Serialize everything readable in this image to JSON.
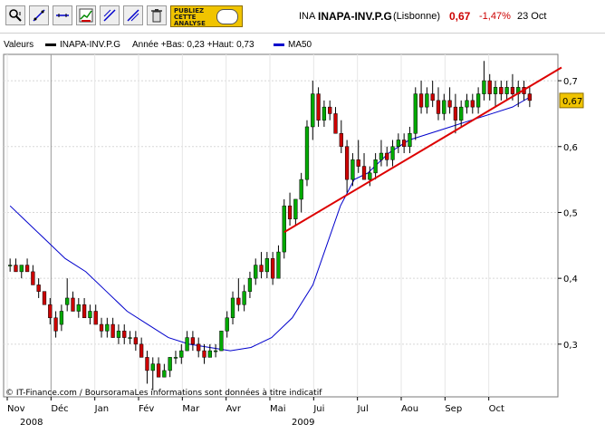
{
  "toolbar": {
    "tools": [
      {
        "icon": "zoom-icon"
      },
      {
        "icon": "line-tool-icon"
      },
      {
        "icon": "horizontal-line-icon"
      },
      {
        "icon": "indicator-icon"
      },
      {
        "icon": "trend-tool-icon"
      },
      {
        "icon": "parallel-tool-icon"
      },
      {
        "icon": "trash-icon"
      }
    ],
    "publish_lines": [
      "PUBLIEZ",
      "CETTE",
      "ANALYSE"
    ]
  },
  "quote": {
    "code": "INA",
    "name": "INAPA-INV.P.G",
    "market": "(Lisbonne)",
    "price": "0,67",
    "change": "-1,47%",
    "date": "23 Oct"
  },
  "legend": {
    "title": "Valeurs",
    "series_name": "INAPA-INV.P.G",
    "range_text": "Année +Bas: 0,23 +Haut: 0,73",
    "ma_name": "MA50",
    "ma_color": "#0000cc",
    "price_color": "#000000"
  },
  "footer": {
    "credit": "© IT-Finance.com / BoursoramaLes informations sont données à titre indicatif"
  },
  "chart_data": {
    "type": "candlestick",
    "y_ticks": [
      "0,7",
      "0,6",
      "0,5",
      "0,4",
      "0,3"
    ],
    "ylim": [
      0.22,
      0.74
    ],
    "x_months": [
      "Nov",
      "Déc",
      "Jan",
      "Fév",
      "Mar",
      "Avr",
      "Mai",
      "Jui",
      "Jul",
      "Aou",
      "Sep",
      "Oct"
    ],
    "x_years": [
      "2008",
      "2009"
    ],
    "last_price_label": "0,67",
    "up_color": "#00aa00",
    "down_color": "#cc0000",
    "trendline_color": "#dd0000",
    "candles": [
      [
        0.42,
        0.43,
        0.41,
        0.42
      ],
      [
        0.42,
        0.43,
        0.41,
        0.41
      ],
      [
        0.41,
        0.42,
        0.4,
        0.42
      ],
      [
        0.42,
        0.43,
        0.41,
        0.41
      ],
      [
        0.41,
        0.42,
        0.39,
        0.39
      ],
      [
        0.39,
        0.4,
        0.37,
        0.38
      ],
      [
        0.38,
        0.38,
        0.36,
        0.36
      ],
      [
        0.36,
        0.37,
        0.33,
        0.34
      ],
      [
        0.34,
        0.35,
        0.31,
        0.32
      ],
      [
        0.33,
        0.36,
        0.32,
        0.35
      ],
      [
        0.36,
        0.4,
        0.35,
        0.37
      ],
      [
        0.37,
        0.38,
        0.35,
        0.35
      ],
      [
        0.35,
        0.37,
        0.34,
        0.36
      ],
      [
        0.36,
        0.37,
        0.34,
        0.34
      ],
      [
        0.34,
        0.36,
        0.33,
        0.35
      ],
      [
        0.35,
        0.36,
        0.33,
        0.33
      ],
      [
        0.33,
        0.34,
        0.31,
        0.32
      ],
      [
        0.32,
        0.34,
        0.31,
        0.33
      ],
      [
        0.33,
        0.34,
        0.31,
        0.31
      ],
      [
        0.31,
        0.33,
        0.3,
        0.32
      ],
      [
        0.32,
        0.33,
        0.3,
        0.31
      ],
      [
        0.31,
        0.32,
        0.3,
        0.31
      ],
      [
        0.31,
        0.32,
        0.29,
        0.3
      ],
      [
        0.3,
        0.31,
        0.28,
        0.28
      ],
      [
        0.28,
        0.29,
        0.24,
        0.26
      ],
      [
        0.26,
        0.28,
        0.23,
        0.27
      ],
      [
        0.27,
        0.28,
        0.25,
        0.25
      ],
      [
        0.25,
        0.27,
        0.25,
        0.26
      ],
      [
        0.26,
        0.28,
        0.25,
        0.28
      ],
      [
        0.28,
        0.29,
        0.27,
        0.28
      ],
      [
        0.28,
        0.3,
        0.27,
        0.29
      ],
      [
        0.29,
        0.32,
        0.29,
        0.31
      ],
      [
        0.31,
        0.32,
        0.29,
        0.3
      ],
      [
        0.3,
        0.31,
        0.28,
        0.29
      ],
      [
        0.29,
        0.3,
        0.27,
        0.28
      ],
      [
        0.28,
        0.3,
        0.28,
        0.29
      ],
      [
        0.29,
        0.3,
        0.28,
        0.29
      ],
      [
        0.29,
        0.32,
        0.29,
        0.32
      ],
      [
        0.32,
        0.35,
        0.31,
        0.34
      ],
      [
        0.34,
        0.38,
        0.33,
        0.37
      ],
      [
        0.37,
        0.4,
        0.35,
        0.36
      ],
      [
        0.36,
        0.39,
        0.35,
        0.38
      ],
      [
        0.38,
        0.41,
        0.37,
        0.4
      ],
      [
        0.4,
        0.43,
        0.39,
        0.42
      ],
      [
        0.42,
        0.44,
        0.4,
        0.41
      ],
      [
        0.41,
        0.44,
        0.4,
        0.43
      ],
      [
        0.43,
        0.44,
        0.39,
        0.4
      ],
      [
        0.4,
        0.45,
        0.4,
        0.44
      ],
      [
        0.44,
        0.52,
        0.43,
        0.51
      ],
      [
        0.51,
        0.53,
        0.48,
        0.49
      ],
      [
        0.49,
        0.52,
        0.48,
        0.52
      ],
      [
        0.52,
        0.56,
        0.5,
        0.55
      ],
      [
        0.55,
        0.64,
        0.54,
        0.63
      ],
      [
        0.63,
        0.7,
        0.61,
        0.68
      ],
      [
        0.68,
        0.69,
        0.63,
        0.64
      ],
      [
        0.64,
        0.67,
        0.63,
        0.66
      ],
      [
        0.66,
        0.67,
        0.64,
        0.65
      ],
      [
        0.65,
        0.66,
        0.62,
        0.62
      ],
      [
        0.62,
        0.64,
        0.59,
        0.6
      ],
      [
        0.6,
        0.61,
        0.53,
        0.55
      ],
      [
        0.55,
        0.59,
        0.54,
        0.58
      ],
      [
        0.58,
        0.61,
        0.56,
        0.57
      ],
      [
        0.57,
        0.59,
        0.55,
        0.55
      ],
      [
        0.55,
        0.57,
        0.54,
        0.56
      ],
      [
        0.56,
        0.59,
        0.55,
        0.58
      ],
      [
        0.58,
        0.61,
        0.57,
        0.59
      ],
      [
        0.59,
        0.6,
        0.57,
        0.58
      ],
      [
        0.58,
        0.61,
        0.57,
        0.6
      ],
      [
        0.6,
        0.62,
        0.59,
        0.61
      ],
      [
        0.61,
        0.62,
        0.59,
        0.6
      ],
      [
        0.6,
        0.63,
        0.59,
        0.62
      ],
      [
        0.62,
        0.69,
        0.61,
        0.68
      ],
      [
        0.68,
        0.7,
        0.65,
        0.66
      ],
      [
        0.66,
        0.69,
        0.65,
        0.68
      ],
      [
        0.68,
        0.7,
        0.66,
        0.67
      ],
      [
        0.67,
        0.69,
        0.64,
        0.65
      ],
      [
        0.65,
        0.68,
        0.64,
        0.67
      ],
      [
        0.67,
        0.69,
        0.65,
        0.66
      ],
      [
        0.66,
        0.68,
        0.62,
        0.64
      ],
      [
        0.64,
        0.67,
        0.63,
        0.66
      ],
      [
        0.66,
        0.68,
        0.65,
        0.67
      ],
      [
        0.67,
        0.68,
        0.65,
        0.66
      ],
      [
        0.66,
        0.69,
        0.65,
        0.68
      ],
      [
        0.68,
        0.73,
        0.67,
        0.7
      ],
      [
        0.7,
        0.71,
        0.67,
        0.68
      ],
      [
        0.68,
        0.7,
        0.66,
        0.69
      ],
      [
        0.69,
        0.7,
        0.67,
        0.68
      ],
      [
        0.68,
        0.7,
        0.67,
        0.69
      ],
      [
        0.69,
        0.71,
        0.67,
        0.68
      ],
      [
        0.68,
        0.7,
        0.66,
        0.69
      ],
      [
        0.69,
        0.7,
        0.67,
        0.68
      ],
      [
        0.68,
        0.69,
        0.66,
        0.67
      ]
    ],
    "ma50": [
      [
        0,
        0.51
      ],
      [
        4,
        0.49
      ],
      [
        10,
        0.46
      ],
      [
        16,
        0.43
      ],
      [
        22,
        0.41
      ],
      [
        28,
        0.38
      ],
      [
        34,
        0.35
      ],
      [
        40,
        0.33
      ],
      [
        46,
        0.31
      ],
      [
        52,
        0.3
      ],
      [
        58,
        0.295
      ],
      [
        64,
        0.29
      ],
      [
        70,
        0.295
      ],
      [
        76,
        0.31
      ],
      [
        82,
        0.34
      ],
      [
        88,
        0.39
      ],
      [
        92,
        0.45
      ],
      [
        96,
        0.51
      ],
      [
        100,
        0.55
      ],
      [
        104,
        0.56
      ],
      [
        110,
        0.59
      ],
      [
        116,
        0.61
      ],
      [
        122,
        0.62
      ],
      [
        128,
        0.63
      ],
      [
        134,
        0.64
      ],
      [
        140,
        0.65
      ],
      [
        146,
        0.66
      ],
      [
        151,
        0.675
      ]
    ],
    "trendline": [
      [
        0.47,
        0.72
      ]
    ]
  }
}
